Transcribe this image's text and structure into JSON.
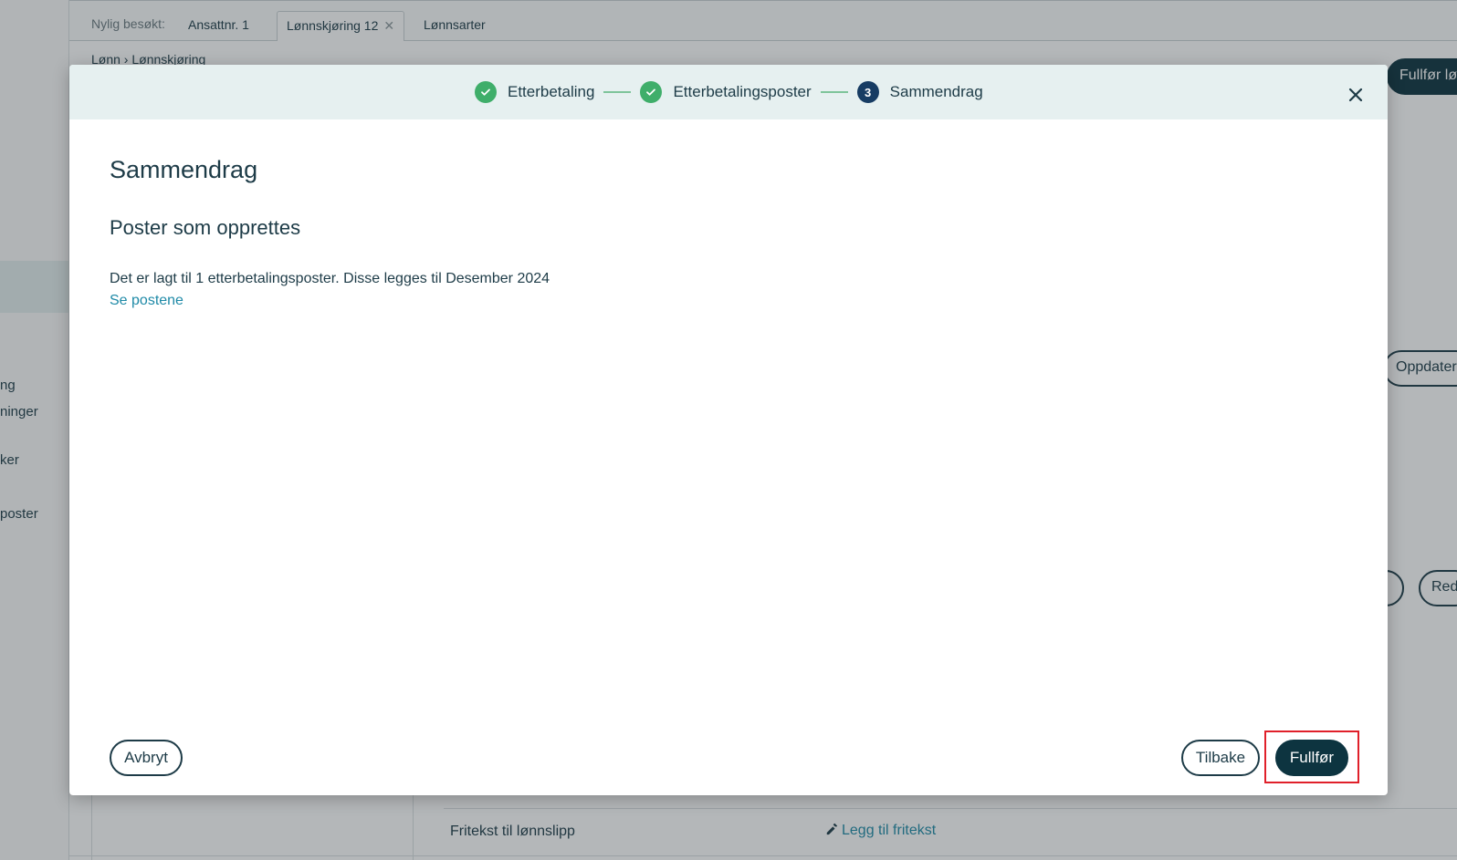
{
  "background": {
    "nav_items": [
      "ng",
      "ninger",
      "ker",
      "poster"
    ],
    "visited_label": "Nylig besøkt:",
    "tabs": [
      {
        "label": "Ansattnr. 1"
      },
      {
        "label": "Lønnskjøring 12"
      },
      {
        "label": "Lønnsarter"
      }
    ],
    "breadcrumb": "Lønn › Lønnskjøring",
    "header_primary_button": "Fullfør lø",
    "update_button": "Oppdater",
    "edit_button": "Red",
    "row_label": "Fritekst til lønnslipp",
    "row_link": "Legg til fritekst"
  },
  "stepper": {
    "steps": [
      {
        "label": "Etterbetaling",
        "state": "done"
      },
      {
        "label": "Etterbetalingsposter",
        "state": "done"
      },
      {
        "label": "Sammendrag",
        "state": "current",
        "number": "3"
      }
    ]
  },
  "modal": {
    "title": "Sammendrag",
    "section_title": "Poster som opprettes",
    "summary_text": "Det er lagt til 1 etterbetalingsposter. Disse legges til Desember 2024",
    "see_link": "Se postene",
    "cancel_label": "Avbryt",
    "back_label": "Tilbake",
    "finish_label": "Fullfør"
  },
  "colors": {
    "done": "#3fae6a",
    "current": "#173c63",
    "primary": "#0d3440",
    "link": "#1f8aa7",
    "highlight": "#e0202a"
  }
}
